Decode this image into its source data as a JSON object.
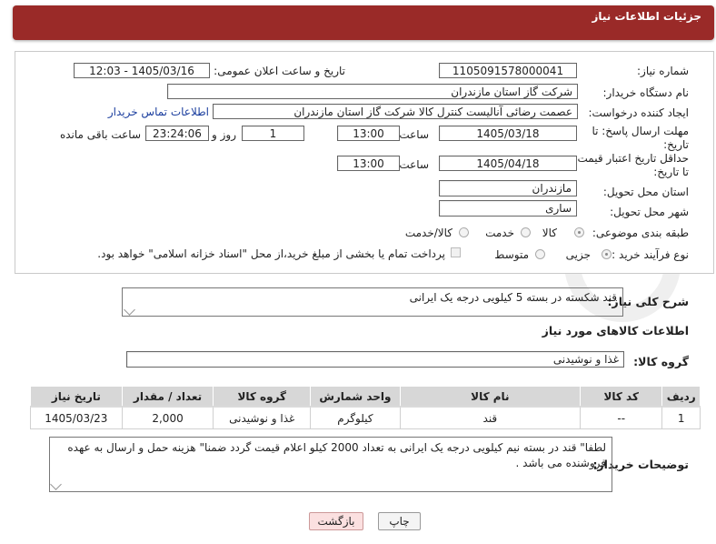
{
  "header": {
    "title": "جزئیات اطلاعات نیاز"
  },
  "form": {
    "need_number_label": "شماره نیاز:",
    "need_number": "1105091578000041",
    "announce_label": "تاریخ و ساعت اعلان عمومی:",
    "announce_value": "1405/03/16 - 12:03",
    "buyer_org_label": "نام دستگاه خریدار:",
    "buyer_org": "شرکت گاز استان مازندران",
    "creator_label": "ایجاد کننده درخواست:",
    "creator": "عصمت رضائی آنالیست کنترل کالا شرکت گاز استان مازندران",
    "contact_link": "اطلاعات تماس خریدار",
    "deadline_label_1": "مهلت ارسال پاسخ: تا",
    "deadline_label_2": "تاریخ:",
    "deadline_date": "1405/03/18",
    "hour_label": "ساعت",
    "deadline_time": "13:00",
    "days_value": "1",
    "days_label": "روز و",
    "remaining_time": "23:24:06",
    "remaining_label": "ساعت باقی مانده",
    "validity_label_1": "حداقل تاریخ اعتبار قیمت:",
    "validity_label_2": "تا تاریخ:",
    "validity_date": "1405/04/18",
    "validity_time": "13:00",
    "province_label": "استان محل تحویل:",
    "province": "مازندران",
    "city_label": "شهر محل تحویل:",
    "city": "ساری",
    "category_label": "طبقه بندی موضوعی:",
    "category_options": [
      "کالا",
      "خدمت",
      "کالا/خدمت"
    ],
    "process_label": "نوع فرآیند خرید :",
    "process_options": [
      "جزیی",
      "متوسط"
    ],
    "payment_note": "پرداخت تمام یا بخشی از مبلغ خرید،از محل \"اسناد خزانه اسلامی\" خواهد بود."
  },
  "description": {
    "label": "شرح کلی نیاز:",
    "text": "قند شکسته  در بسته 5 کیلویی درجه یک ایرانی"
  },
  "goods": {
    "section_title": "اطلاعات کالاهای مورد نیاز",
    "group_label": "گروه کالا:",
    "group_value": "غذا و نوشیدنی",
    "columns": [
      "ردیف",
      "کد کالا",
      "نام کالا",
      "واحد شمارش",
      "گروه کالا",
      "تعداد / مقدار",
      "تاریخ نیاز"
    ],
    "rows": [
      [
        "1",
        "--",
        "قند",
        "کیلوگرم",
        "غذا و نوشیدنی",
        "2,000",
        "1405/03/23"
      ]
    ]
  },
  "notes": {
    "label": "توضیحات خریدار:",
    "text": "لطفا\" قند در بسته نیم کیلویی درجه یک ایرانی به تعداد 2000 کیلو اعلام قیمت گردد ضمنا\" هزینه حمل و ارسال به عهده فروشنده می باشد ."
  },
  "buttons": {
    "print": "چاپ",
    "back": "بازگشت"
  },
  "watermark": {
    "text": "AriaTender.neT"
  },
  "colors": {
    "header_bg": "#9a2a28",
    "table_header_bg": "#d7d7d7",
    "link": "#1b3e9e",
    "back_button_bg": "#fbe0e0"
  }
}
